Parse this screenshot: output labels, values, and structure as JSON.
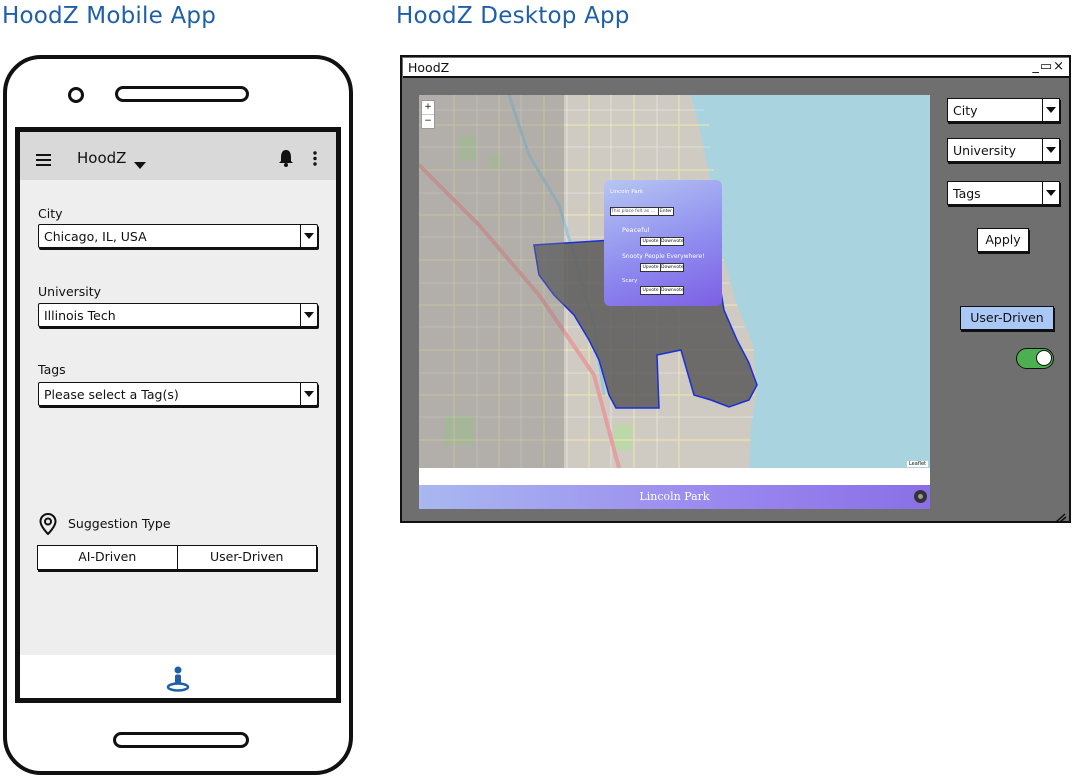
{
  "headings": {
    "mobile": "HoodZ Mobile App",
    "desktop": "HoodZ Desktop App"
  },
  "mobile": {
    "app_title": "HoodZ",
    "city": {
      "label": "City",
      "value": "Chicago, IL, USA"
    },
    "university": {
      "label": "University",
      "value": "Illinois Tech"
    },
    "tags": {
      "label": "Tags",
      "value": "Please select a Tag(s)"
    },
    "suggestion": {
      "label": "Suggestion Type",
      "options": [
        "AI-Driven",
        "User-Driven"
      ]
    },
    "icons": [
      "menu-icon",
      "caret-down-icon",
      "bell-icon",
      "more-vert-icon",
      "location-pin-icon",
      "person-pin-icon"
    ]
  },
  "desktop": {
    "window_title": "HoodZ",
    "window_controls": "_▭×",
    "city_select": "City",
    "university_select": "University",
    "tags_select": "Tags",
    "apply_label": "Apply",
    "mode_label": "User-Driven",
    "toggle_on": true,
    "map": {
      "zoom_in": "+",
      "zoom_out": "−",
      "attribution": "Leaflet",
      "banner_title": "Lincoln Park",
      "popup": {
        "title": "Lincoln Park",
        "input_placeholder": "This place felt as ...",
        "enter_label": "Enter",
        "comments": [
          {
            "text": "Peaceful",
            "like": "Upvote",
            "comment": "Downvote"
          },
          {
            "text": "Snooty People Everywhere!",
            "like": "Upvote",
            "comment": "Downvote"
          },
          {
            "text": "Scary",
            "like": "Upvote",
            "comment": "Downvote"
          }
        ]
      }
    },
    "colors": {
      "accent_blue": "#1f5fa8",
      "toggle_green": "#4caf50",
      "mode_button": "#a9c8f5"
    }
  }
}
